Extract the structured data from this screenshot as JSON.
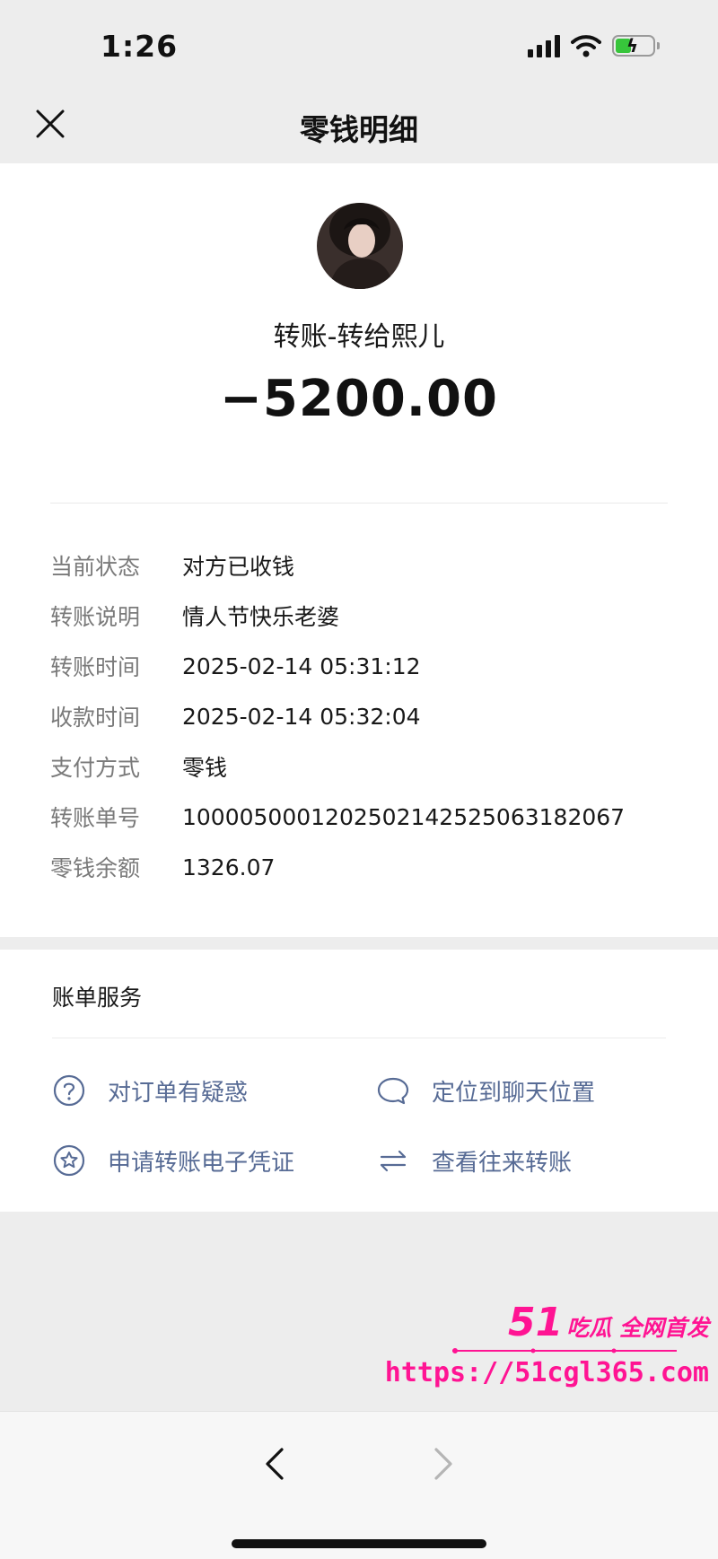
{
  "status_bar": {
    "time": "1:26"
  },
  "nav": {
    "title": "零钱明细"
  },
  "transfer": {
    "title": "转账-转给熙儿",
    "amount": "−5200.00"
  },
  "details": [
    {
      "label": "当前状态",
      "value": "对方已收钱"
    },
    {
      "label": "转账说明",
      "value": "情人节快乐老婆"
    },
    {
      "label": "转账时间",
      "value": "2025-02-14 05:31:12"
    },
    {
      "label": "收款时间",
      "value": "2025-02-14 05:32:04"
    },
    {
      "label": "支付方式",
      "value": "零钱"
    },
    {
      "label": "转账单号",
      "value": "1000050001202502142525063182067"
    },
    {
      "label": "零钱余额",
      "value": "1326.07"
    }
  ],
  "services": {
    "title": "账单服务",
    "items": [
      {
        "label": "对订单有疑惑",
        "icon": "question-circle-icon"
      },
      {
        "label": "定位到聊天位置",
        "icon": "chat-bubble-icon"
      },
      {
        "label": "申请转账电子凭证",
        "icon": "star-circle-icon"
      },
      {
        "label": "查看往来转账",
        "icon": "swap-arrows-icon"
      }
    ]
  },
  "watermark": {
    "number": "51",
    "tagline": "吃瓜 全网首发",
    "url": "https://51cgl365.com"
  },
  "colors": {
    "link": "#576b95",
    "label": "#7a7a7a",
    "watermark": "#ff1493",
    "background": "#ededed"
  }
}
